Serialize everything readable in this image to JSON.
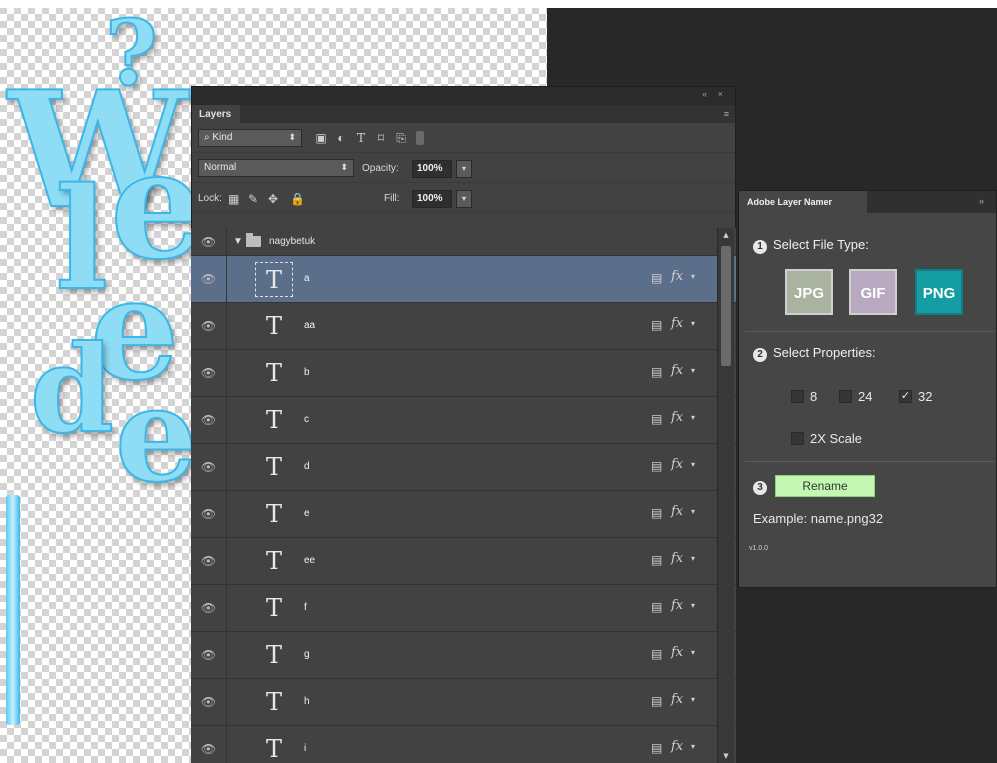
{
  "canvas": {
    "glyphs": [
      "?",
      "W",
      "l",
      "e",
      "e",
      "d",
      "e"
    ]
  },
  "layers_panel": {
    "topbar_controls": "« ×",
    "tab": "Layers",
    "menu_icon": "menu-icon",
    "filter_kind": "Kind",
    "blend_mode": "Normal",
    "opacity_label": "Opacity:",
    "opacity_value": "100%",
    "lock_label": "Lock:",
    "fill_label": "Fill:",
    "fill_value": "100%",
    "group": {
      "name": "nagybetuk"
    },
    "layers": [
      {
        "name": "a",
        "selected": true
      },
      {
        "name": "aa",
        "selected": false
      },
      {
        "name": "b",
        "selected": false
      },
      {
        "name": "c",
        "selected": false
      },
      {
        "name": "d",
        "selected": false
      },
      {
        "name": "e",
        "selected": false
      },
      {
        "name": "ee",
        "selected": false
      },
      {
        "name": "f",
        "selected": false
      },
      {
        "name": "g",
        "selected": false
      },
      {
        "name": "h",
        "selected": false
      },
      {
        "name": "i",
        "selected": false
      }
    ],
    "thumb_glyph": "T",
    "fx_label": "fx"
  },
  "namer_panel": {
    "tab": "Adobe Layer Namer",
    "collapse": "»",
    "step1": {
      "num": "1",
      "label": "Select File Type:"
    },
    "file_types": [
      {
        "label": "JPG",
        "color": "#a9b3a0"
      },
      {
        "label": "GIF",
        "color": "#b8a8c0"
      },
      {
        "label": "PNG",
        "color": "#149ea3"
      }
    ],
    "step2": {
      "num": "2",
      "label": "Select Properties:"
    },
    "properties": [
      {
        "label": "8",
        "checked": false
      },
      {
        "label": "24",
        "checked": false
      },
      {
        "label": "32",
        "checked": true
      }
    ],
    "scale_option": {
      "label": "2X Scale",
      "checked": false
    },
    "step3": {
      "num": "3"
    },
    "rename_button": "Rename",
    "example": "Example: name.png32",
    "version": "v1.0.0"
  }
}
